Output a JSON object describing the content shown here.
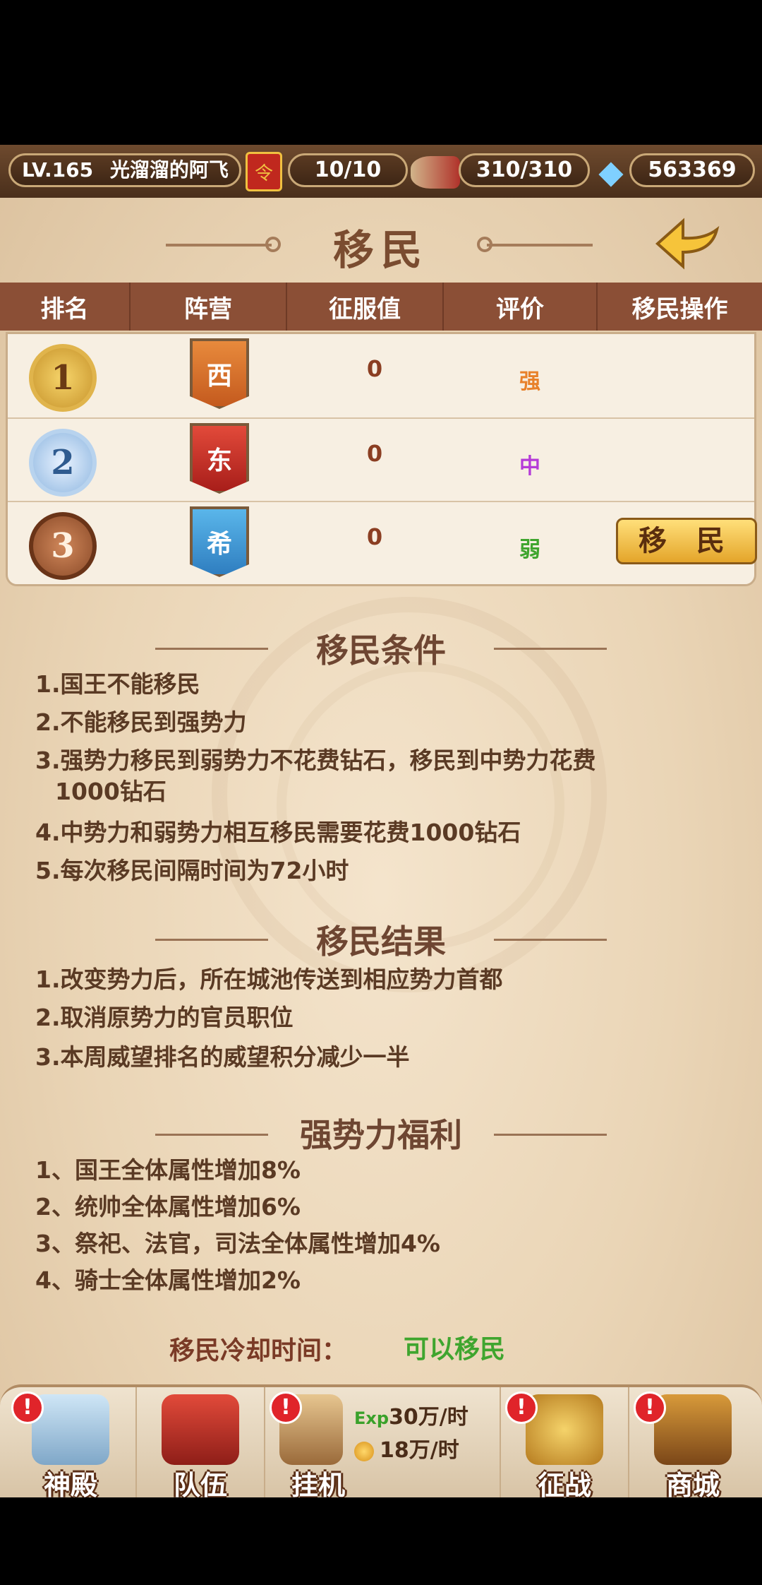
{
  "top_bar": {
    "level": "LV.165",
    "player_name": "光溜溜的阿飞",
    "stamina": "10/10",
    "energy": "310/310",
    "diamonds": "563369",
    "scroll_icon_glyph": "令"
  },
  "header": {
    "title": "移民"
  },
  "table": {
    "columns": [
      "排名",
      "阵营",
      "征服值",
      "评价",
      "移民操作"
    ],
    "rows": [
      {
        "rank": "1",
        "faction": "西",
        "score": "0",
        "rating": "强",
        "rating_color": "#e8812a"
      },
      {
        "rank": "2",
        "faction": "东",
        "score": "0",
        "rating": "中",
        "rating_color": "#b53bd8"
      },
      {
        "rank": "3",
        "faction": "希",
        "score": "0",
        "rating": "弱",
        "rating_color": "#3fa52e",
        "action": "移 民"
      }
    ]
  },
  "conditions": {
    "title": "移民条件",
    "items": [
      "1.国王不能移民",
      "2.不能移民到强势力",
      "3.强势力移民到弱势力不花费钻石，移民到中势力花费",
      "1000钻石",
      "4.中势力和弱势力相互移民需要花费1000钻石",
      "5.每次移民间隔时间为72小时"
    ]
  },
  "results": {
    "title": "移民结果",
    "items": [
      "1.改变势力后，所在城池传送到相应势力首都",
      "2.取消原势力的官员职位",
      "3.本周威望排名的威望积分减少一半"
    ]
  },
  "benefits": {
    "title": "强势力福利",
    "items": [
      "1、国王全体属性增加8%",
      "2、统帅全体属性增加6%",
      "3、祭祀、法官，司法全体属性增加4%",
      "4、骑士全体属性增加2%"
    ]
  },
  "cooldown": {
    "label": "移民冷却时间：",
    "value": "可以移民"
  },
  "bottom_nav": {
    "temple": "神殿",
    "team": "队伍",
    "idle": "挂机",
    "idle_exp_tag": "Exp",
    "idle_exp": "30万/时",
    "idle_coin": "18万/时",
    "battle": "征战",
    "shop": "商城",
    "alert_glyph": "!"
  }
}
